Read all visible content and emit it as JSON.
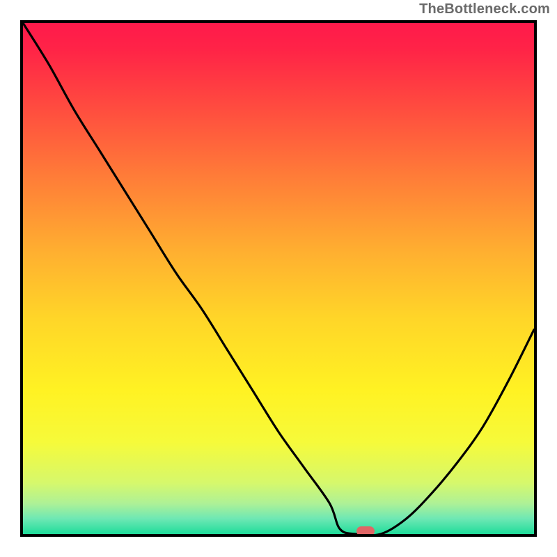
{
  "watermark": "TheBottleneck.com",
  "chart_data": {
    "type": "line",
    "title": "",
    "xlabel": "",
    "ylabel": "",
    "xlim": [
      0,
      100
    ],
    "ylim": [
      0,
      100
    ],
    "x": [
      0,
      5,
      10,
      15,
      20,
      25,
      30,
      35,
      40,
      45,
      50,
      55,
      60,
      62,
      65,
      70,
      75,
      80,
      85,
      90,
      95,
      100
    ],
    "values": [
      100,
      92,
      83,
      75,
      67,
      59,
      51,
      44,
      36,
      28,
      20,
      13,
      6,
      1,
      0,
      0,
      3,
      8,
      14,
      21,
      30,
      40
    ],
    "minimum_x": 67,
    "marker_x": 67,
    "marker_y": 0,
    "gradient_stops": [
      {
        "offset": 0.0,
        "color": "#ff1a4b"
      },
      {
        "offset": 0.05,
        "color": "#ff2347"
      },
      {
        "offset": 0.15,
        "color": "#ff4640"
      },
      {
        "offset": 0.3,
        "color": "#ff7c38"
      },
      {
        "offset": 0.45,
        "color": "#ffb030"
      },
      {
        "offset": 0.58,
        "color": "#ffd628"
      },
      {
        "offset": 0.72,
        "color": "#fff223"
      },
      {
        "offset": 0.82,
        "color": "#f6fa3a"
      },
      {
        "offset": 0.9,
        "color": "#d6f86c"
      },
      {
        "offset": 0.94,
        "color": "#aef196"
      },
      {
        "offset": 0.97,
        "color": "#6ee8b4"
      },
      {
        "offset": 1.0,
        "color": "#1fdc9a"
      }
    ]
  }
}
